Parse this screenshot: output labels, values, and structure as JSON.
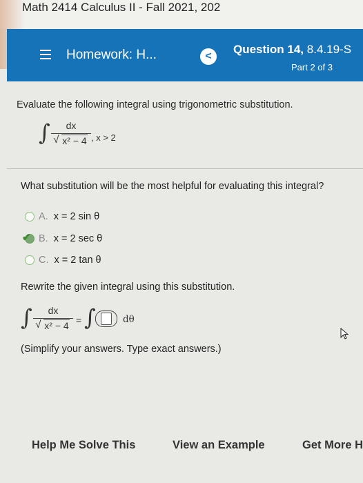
{
  "titlebar": {
    "title": "Math 2414 Calculus II - Fall 2021, 202"
  },
  "header": {
    "homework_title": "Homework: H...",
    "back_symbol": "<",
    "question_label": "Question 14,",
    "question_number": "8.4.19-S",
    "part": "Part 2 of 3"
  },
  "problem": {
    "prompt": "Evaluate the following integral using trigonometric substitution.",
    "numerator": "dx",
    "radicand": "x² − 4",
    "condition": ", x > 2"
  },
  "question": {
    "text": "What substitution will be the most helpful for evaluating this integral?",
    "options": [
      {
        "letter": "A.",
        "text": "x = 2 sin θ",
        "selected": false
      },
      {
        "letter": "B.",
        "text": "x = 2 sec θ",
        "selected": true
      },
      {
        "letter": "C.",
        "text": "x = 2 tan θ",
        "selected": false
      }
    ]
  },
  "rewrite": {
    "text": "Rewrite the given integral using this substitution.",
    "numerator": "dx",
    "radicand": "x² − 4",
    "equals": "=",
    "dtheta": "dθ",
    "instruction": "(Simplify your answers. Type exact answers.)"
  },
  "footer": {
    "help": "Help Me Solve This",
    "example": "View an Example",
    "more": "Get More H"
  },
  "colors": {
    "header_bg": "#1773b8",
    "selected_check": "#3c8a2c"
  }
}
